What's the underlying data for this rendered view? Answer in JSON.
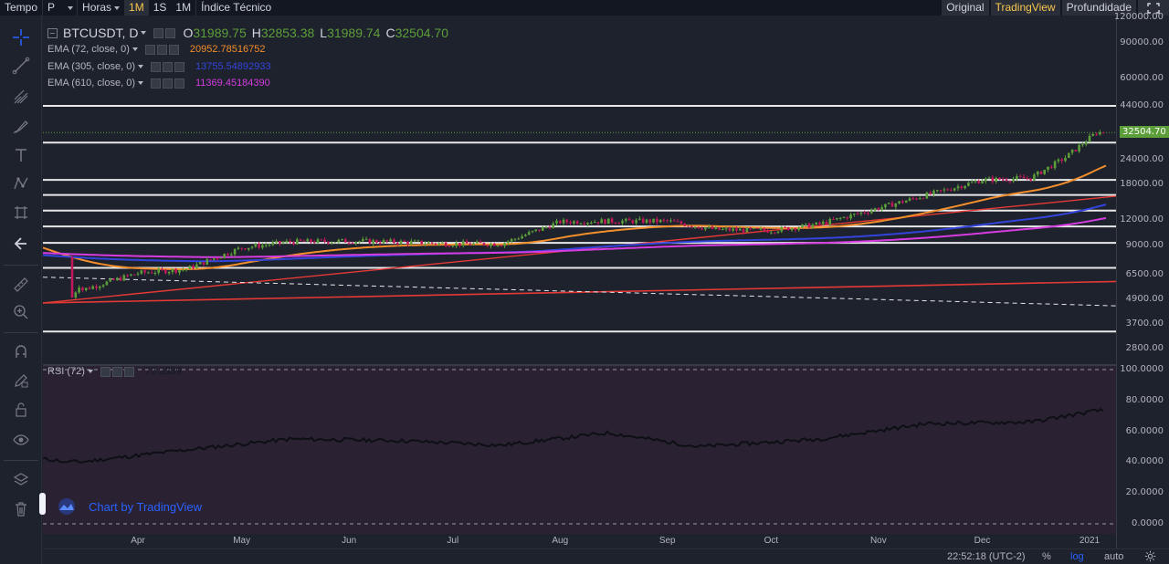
{
  "topbar": {
    "tempo_label": "Tempo",
    "period_value": "P",
    "horas_label": "Horas",
    "btn_1m_a": "1M",
    "btn_1s": "1S",
    "btn_1m_b": "1M",
    "indicator_label": "Índice Técnico",
    "view_original": "Original",
    "view_tradingview": "TradingView",
    "view_depth": "Profundidade"
  },
  "legend": {
    "symbol": "BTCUSDT, D",
    "open_label": "O",
    "open_value": "31989.75",
    "high_label": "H",
    "high_value": "32853.38",
    "low_label": "L",
    "low_value": "31989.74",
    "close_label": "C",
    "close_value": "32504.70",
    "indicators": [
      {
        "name": "EMA (72, close, 0)",
        "value": "20952.78516752",
        "color": "#f28e2b"
      },
      {
        "name": "EMA (305, close, 0)",
        "value": "13755.54892933",
        "color": "#3344dd"
      },
      {
        "name": "EMA (610, close, 0)",
        "value": "11369.45184390",
        "color": "#d63ce0"
      }
    ]
  },
  "rsi": {
    "name": "RSI (72)",
    "value": "73.3339"
  },
  "price_axis": {
    "labels": [
      "120000.00",
      "90000.00",
      "60000.00",
      "44000.00",
      "32504.70",
      "24000.00",
      "18000.00",
      "12000.00",
      "9000.00",
      "6500.00",
      "4900.00",
      "3700.00",
      "2800.00"
    ],
    "last_price": "32504.70",
    "rsi_labels": [
      "100.0000",
      "80.0000",
      "60.0000",
      "40.0000",
      "20.0000",
      "0.0000"
    ]
  },
  "time_axis": {
    "labels": [
      "Apr",
      "May",
      "Jun",
      "Jul",
      "Aug",
      "Sep",
      "Oct",
      "Nov",
      "Dec",
      "2021"
    ]
  },
  "bottombar": {
    "clock": "22:52:18 (UTC-2)",
    "percent": "%",
    "log": "log",
    "auto": "auto"
  },
  "watermark": "Chart by TradingView",
  "colors": {
    "background": "#1e222d",
    "up": "#5c9e3a",
    "down": "#c2185b",
    "ema72": "#f28e2b",
    "ema305": "#3344dd",
    "ema610": "#d63ce0",
    "trend_red": "#e53935",
    "rsi_bg": "#2a2233",
    "accent": "#f9c74f"
  },
  "chart_data": {
    "type": "candlestick",
    "scale": "log",
    "dates_visible": [
      "2020-03-13",
      "2021-01-05"
    ],
    "ylim": [
      2800,
      120000
    ],
    "horizontal_levels": [
      44000,
      29000,
      19000,
      16000,
      13400,
      11200,
      9300,
      7000,
      3400
    ],
    "last_close": 32504.7,
    "approx_close_series": [
      {
        "date": "2020-03-15",
        "close": 5400
      },
      {
        "date": "2020-04-01",
        "close": 6600
      },
      {
        "date": "2020-04-15",
        "close": 6900
      },
      {
        "date": "2020-05-01",
        "close": 8800
      },
      {
        "date": "2020-05-15",
        "close": 9400
      },
      {
        "date": "2020-06-01",
        "close": 9500
      },
      {
        "date": "2020-06-15",
        "close": 9400
      },
      {
        "date": "2020-07-01",
        "close": 9200
      },
      {
        "date": "2020-07-15",
        "close": 9200
      },
      {
        "date": "2020-08-01",
        "close": 11800
      },
      {
        "date": "2020-08-15",
        "close": 11900
      },
      {
        "date": "2020-09-01",
        "close": 11900
      },
      {
        "date": "2020-09-15",
        "close": 10800
      },
      {
        "date": "2020-10-01",
        "close": 10700
      },
      {
        "date": "2020-10-15",
        "close": 11500
      },
      {
        "date": "2020-11-01",
        "close": 13800
      },
      {
        "date": "2020-11-15",
        "close": 16000
      },
      {
        "date": "2020-12-01",
        "close": 19000
      },
      {
        "date": "2020-12-15",
        "close": 19400
      },
      {
        "date": "2020-12-25",
        "close": 24500
      },
      {
        "date": "2021-01-03",
        "close": 32504.7
      }
    ],
    "rsi_approx": [
      {
        "date": "2020-03-15",
        "value": 40
      },
      {
        "date": "2020-04-15",
        "value": 48
      },
      {
        "date": "2020-05-15",
        "value": 55
      },
      {
        "date": "2020-06-15",
        "value": 54
      },
      {
        "date": "2020-07-15",
        "value": 51
      },
      {
        "date": "2020-08-15",
        "value": 59
      },
      {
        "date": "2020-09-10",
        "value": 50
      },
      {
        "date": "2020-10-15",
        "value": 55
      },
      {
        "date": "2020-11-15",
        "value": 65
      },
      {
        "date": "2020-12-15",
        "value": 66
      },
      {
        "date": "2021-01-03",
        "value": 73.3339
      }
    ],
    "rsi_ylim": [
      0,
      100
    ]
  }
}
